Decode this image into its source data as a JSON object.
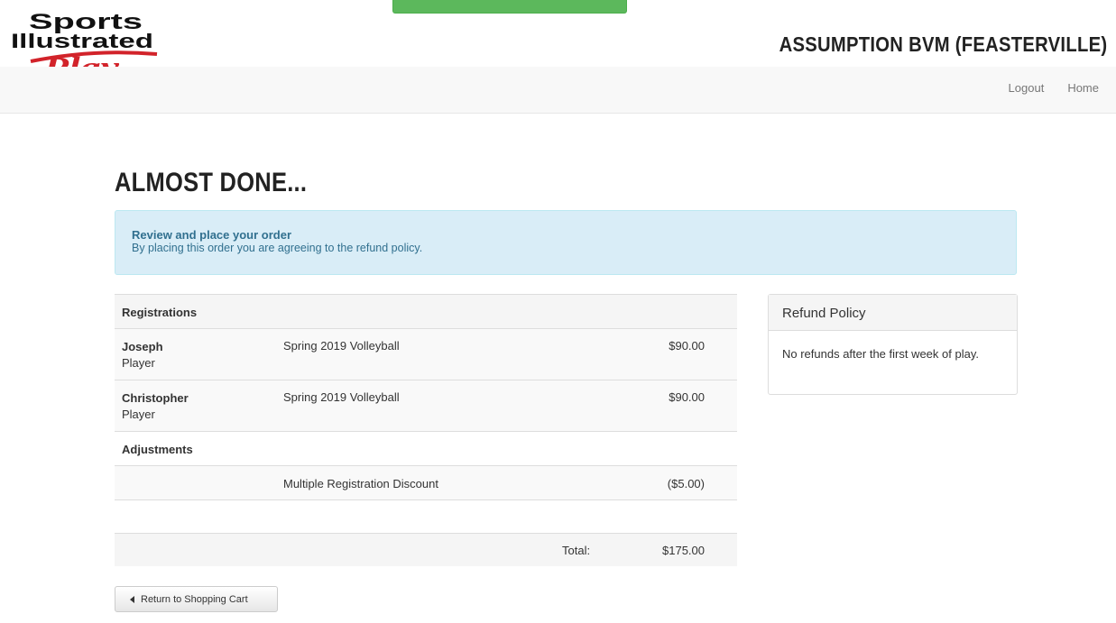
{
  "header": {
    "logo_text": [
      "Sports",
      "Illustrated",
      "Play"
    ],
    "org_title": "ASSUMPTION BVM (FEASTERVILLE)"
  },
  "nav": {
    "logout": "Logout",
    "home": "Home"
  },
  "page": {
    "heading": "ALMOST DONE...",
    "alert_title": "Review and place your order",
    "alert_text": "By placing this order you are agreeing to the refund policy."
  },
  "cart": {
    "registrations_label": "Registrations",
    "items": [
      {
        "name": "Joseph",
        "role": "Player",
        "program": "Spring 2019 Volleyball",
        "amount": "$90.00"
      },
      {
        "name": "Christopher",
        "role": "Player",
        "program": "Spring 2019 Volleyball",
        "amount": "$90.00"
      }
    ],
    "adjustments_label": "Adjustments",
    "adjustment": {
      "description": "Multiple Registration Discount",
      "amount": "($5.00)"
    },
    "total_label": "Total:",
    "total_amount": "$175.00"
  },
  "refund_policy": {
    "title": "Refund Policy",
    "text": "No refunds after the first week of play."
  },
  "buttons": {
    "return_cart": "Return to Shopping Cart"
  },
  "colors": {
    "accent_green": "#5cb85c",
    "alert_bg": "#d9edf7",
    "alert_text": "#31708f",
    "logo_red": "#d2232a"
  },
  "icons": {
    "back": "caret-left-icon"
  }
}
